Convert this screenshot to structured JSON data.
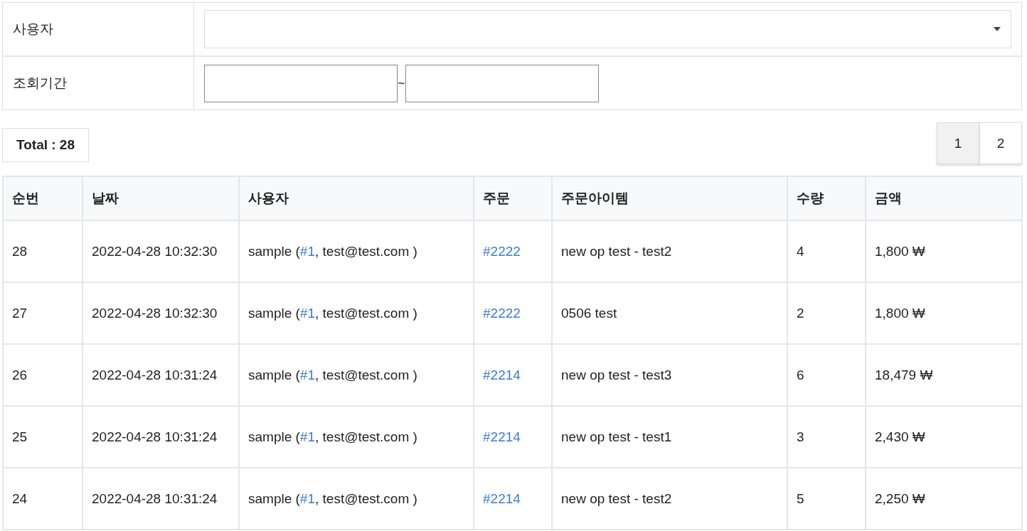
{
  "filters": {
    "user_label": "사용자",
    "period_label": "조회기간",
    "period_separator": "~"
  },
  "total": "Total : 28",
  "pages": [
    {
      "label": "1",
      "selected": true
    },
    {
      "label": "2",
      "selected": false
    }
  ],
  "table": {
    "columns": [
      "순번",
      "날짜",
      "사용자",
      "주문",
      "주문아이템",
      "수량",
      "금액"
    ],
    "rows": [
      {
        "no": "28",
        "date": "2022-04-28 10:32:30",
        "user_before": "sample (",
        "user_link": "#1",
        "user_after": ", test@test.com )",
        "order": "#2222",
        "item": "new op test - test2",
        "qty": "4",
        "amount": "1,800 ₩"
      },
      {
        "no": "27",
        "date": "2022-04-28 10:32:30",
        "user_before": "sample (",
        "user_link": "#1",
        "user_after": ", test@test.com )",
        "order": "#2222",
        "item": "0506 test",
        "qty": "2",
        "amount": "1,800 ₩"
      },
      {
        "no": "26",
        "date": "2022-04-28 10:31:24",
        "user_before": "sample (",
        "user_link": "#1",
        "user_after": ", test@test.com )",
        "order": "#2214",
        "item": "new op test - test3",
        "qty": "6",
        "amount": "18,479 ₩"
      },
      {
        "no": "25",
        "date": "2022-04-28 10:31:24",
        "user_before": "sample (",
        "user_link": "#1",
        "user_after": ", test@test.com )",
        "order": "#2214",
        "item": "new op test - test1",
        "qty": "3",
        "amount": "2,430 ₩"
      },
      {
        "no": "24",
        "date": "2022-04-28 10:31:24",
        "user_before": "sample (",
        "user_link": "#1",
        "user_after": ", test@test.com )",
        "order": "#2214",
        "item": "new op test - test2",
        "qty": "5",
        "amount": "2,250 ₩"
      }
    ]
  }
}
